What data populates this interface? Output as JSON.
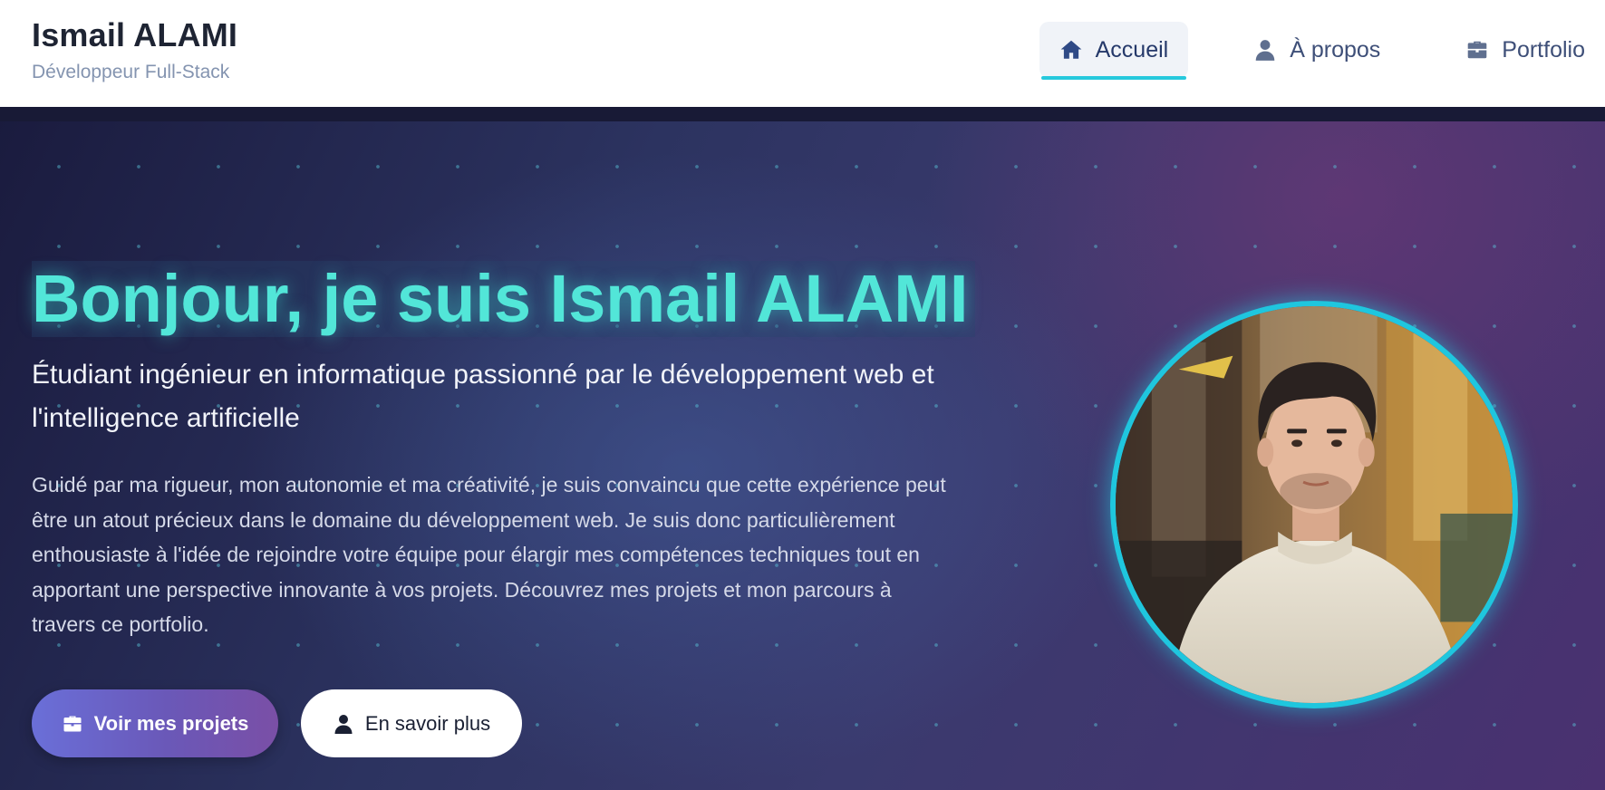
{
  "header": {
    "name": "Ismail ALAMI",
    "role": "Développeur Full-Stack",
    "nav": [
      {
        "label": "Accueil",
        "icon": "home-icon",
        "active": true
      },
      {
        "label": "À propos",
        "icon": "user-icon",
        "active": false
      },
      {
        "label": "Portfolio",
        "icon": "briefcase-icon",
        "active": false
      }
    ]
  },
  "hero": {
    "title": "Bonjour, je suis Ismail ALAMI",
    "subtitle": "Étudiant ingénieur en informatique passionné par le développement web et l'intelligence artificielle",
    "description": "Guidé par ma rigueur, mon autonomie et ma créativité, je suis convaincu que cette expérience peut être un atout précieux dans le domaine du développement web. Je suis donc particulièrement enthousiaste à l'idée de rejoindre votre équipe pour élargir mes compétences techniques tout en apportant une perspective innovante à vos projets. Découvrez mes projets et mon parcours à travers ce portfolio.",
    "primary_button": {
      "label": "Voir mes projets",
      "icon": "briefcase-icon"
    },
    "secondary_button": {
      "label": "En savoir plus",
      "icon": "user-icon"
    }
  },
  "colors": {
    "accent": "#26c9dd",
    "title": "#52e6d8",
    "nav_text": "#3e4f78"
  }
}
